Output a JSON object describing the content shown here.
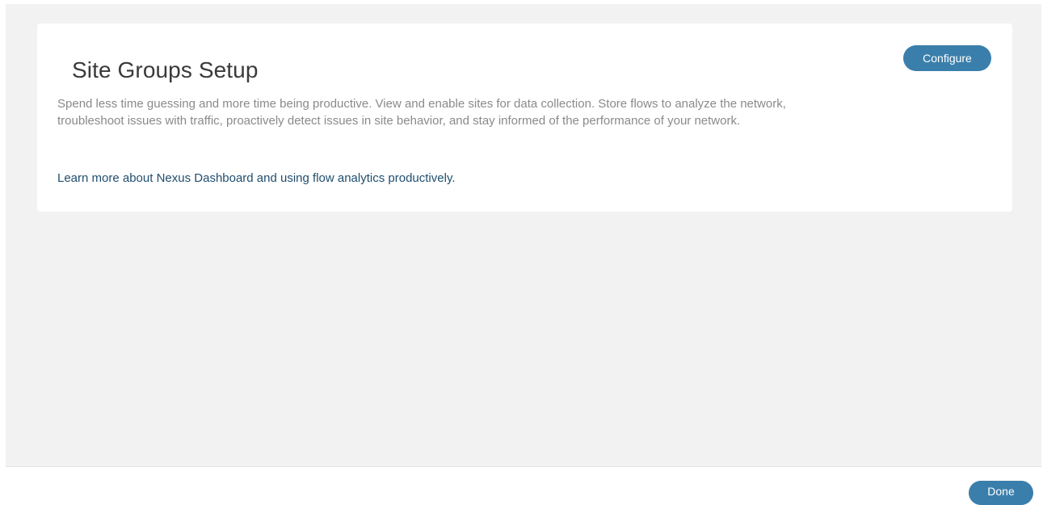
{
  "card": {
    "title": "Site Groups Setup",
    "description": "Spend less time guessing and more time being productive. View and enable sites for data collection. Store flows to analyze the network, troubleshoot issues with traffic, proactively detect issues in site behavior, and stay informed of the performance of your network.",
    "learn_more_link": "Learn more about Nexus Dashboard and using flow analytics productively.",
    "configure_label": "Configure"
  },
  "footer": {
    "done_label": "Done"
  },
  "colors": {
    "accent": "#3a7fab",
    "link": "#1f4e6e",
    "page_background": "#f2f2f2"
  }
}
